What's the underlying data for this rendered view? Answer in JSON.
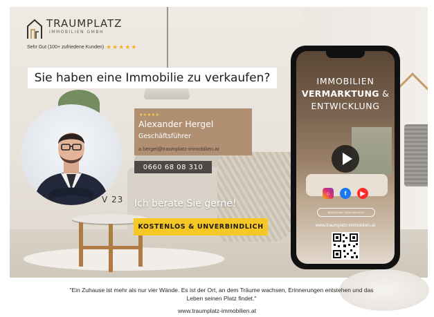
{
  "brand": {
    "name": "TRAUMPLATZ",
    "subtitle": "IMMOBILIEN GMBH",
    "rating_text": "Sehr Gut (100+ zufriedene Kunden)",
    "rating_stars": "★★★★★"
  },
  "headline": "Sie haben eine Immobilie zu verkaufen?",
  "wall_numbers": "V 23",
  "contact": {
    "stars": "★★★★★",
    "name": "Alexander Hergel",
    "role": "Geschäftsführer",
    "email": "a.hergel@traumplatz-immobilien.at",
    "phone": "0660 68 08 310"
  },
  "advice": "Ich berate Sie gerne!",
  "cta": "KOSTENLOS & UNVERBINDLICH",
  "phone_screen": {
    "title_line1": "IMMOBILIEN",
    "title_bold": "VERMARKTUNG",
    "title_amp": " &",
    "title_line3": "ENTWICKLUNG",
    "button_text": "BERATUNG VEREINBAREN",
    "url": "www.traumplatz-immobilien.at",
    "socials": [
      "instagram-icon",
      "facebook-icon",
      "youtube-icon"
    ]
  },
  "quote": "\"Ein Zuhause ist mehr als nur vier Wände. Es ist der Ort, an dem Träume wachsen, Erinnerungen entstehen und das Leben seinen Platz findet.\"",
  "footer_url": "www.traumplatz-immobilien.at",
  "colors": {
    "accent_brown": "#b08f73",
    "cta_yellow": "#f5c825",
    "phone_box": "#4d4946",
    "star_gold": "#f0b429"
  }
}
